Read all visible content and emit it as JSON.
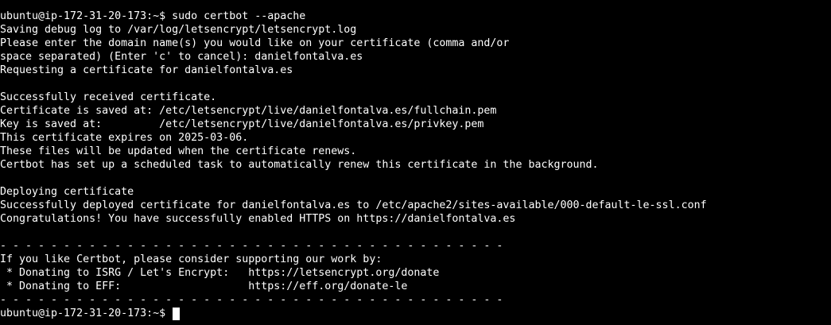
{
  "terminal": {
    "lines": [
      "ubuntu@ip-172-31-20-173:~$ sudo certbot --apache",
      "Saving debug log to /var/log/letsencrypt/letsencrypt.log",
      "Please enter the domain name(s) you would like on your certificate (comma and/or",
      "space separated) (Enter 'c' to cancel): danielfontalva.es",
      "Requesting a certificate for danielfontalva.es",
      "",
      "Successfully received certificate.",
      "Certificate is saved at: /etc/letsencrypt/live/danielfontalva.es/fullchain.pem",
      "Key is saved at:         /etc/letsencrypt/live/danielfontalva.es/privkey.pem",
      "This certificate expires on 2025-03-06.",
      "These files will be updated when the certificate renews.",
      "Certbot has set up a scheduled task to automatically renew this certificate in the background.",
      "",
      "Deploying certificate",
      "Successfully deployed certificate for danielfontalva.es to /etc/apache2/sites-available/000-default-le-ssl.conf",
      "Congratulations! You have successfully enabled HTTPS on https://danielfontalva.es",
      "",
      "- - - - - - - - - - - - - - - - - - - - - - - - - - - - - - - - - - - - - - - -",
      "If you like Certbot, please consider supporting our work by:",
      " * Donating to ISRG / Let's Encrypt:   https://letsencrypt.org/donate",
      " * Donating to EFF:                    https://eff.org/donate-le",
      "- - - - - - - - - - - - - - - - - - - - - - - - - - - - - - - - - - - - - - - -"
    ],
    "prompt": "ubuntu@ip-172-31-20-173:~$ "
  }
}
